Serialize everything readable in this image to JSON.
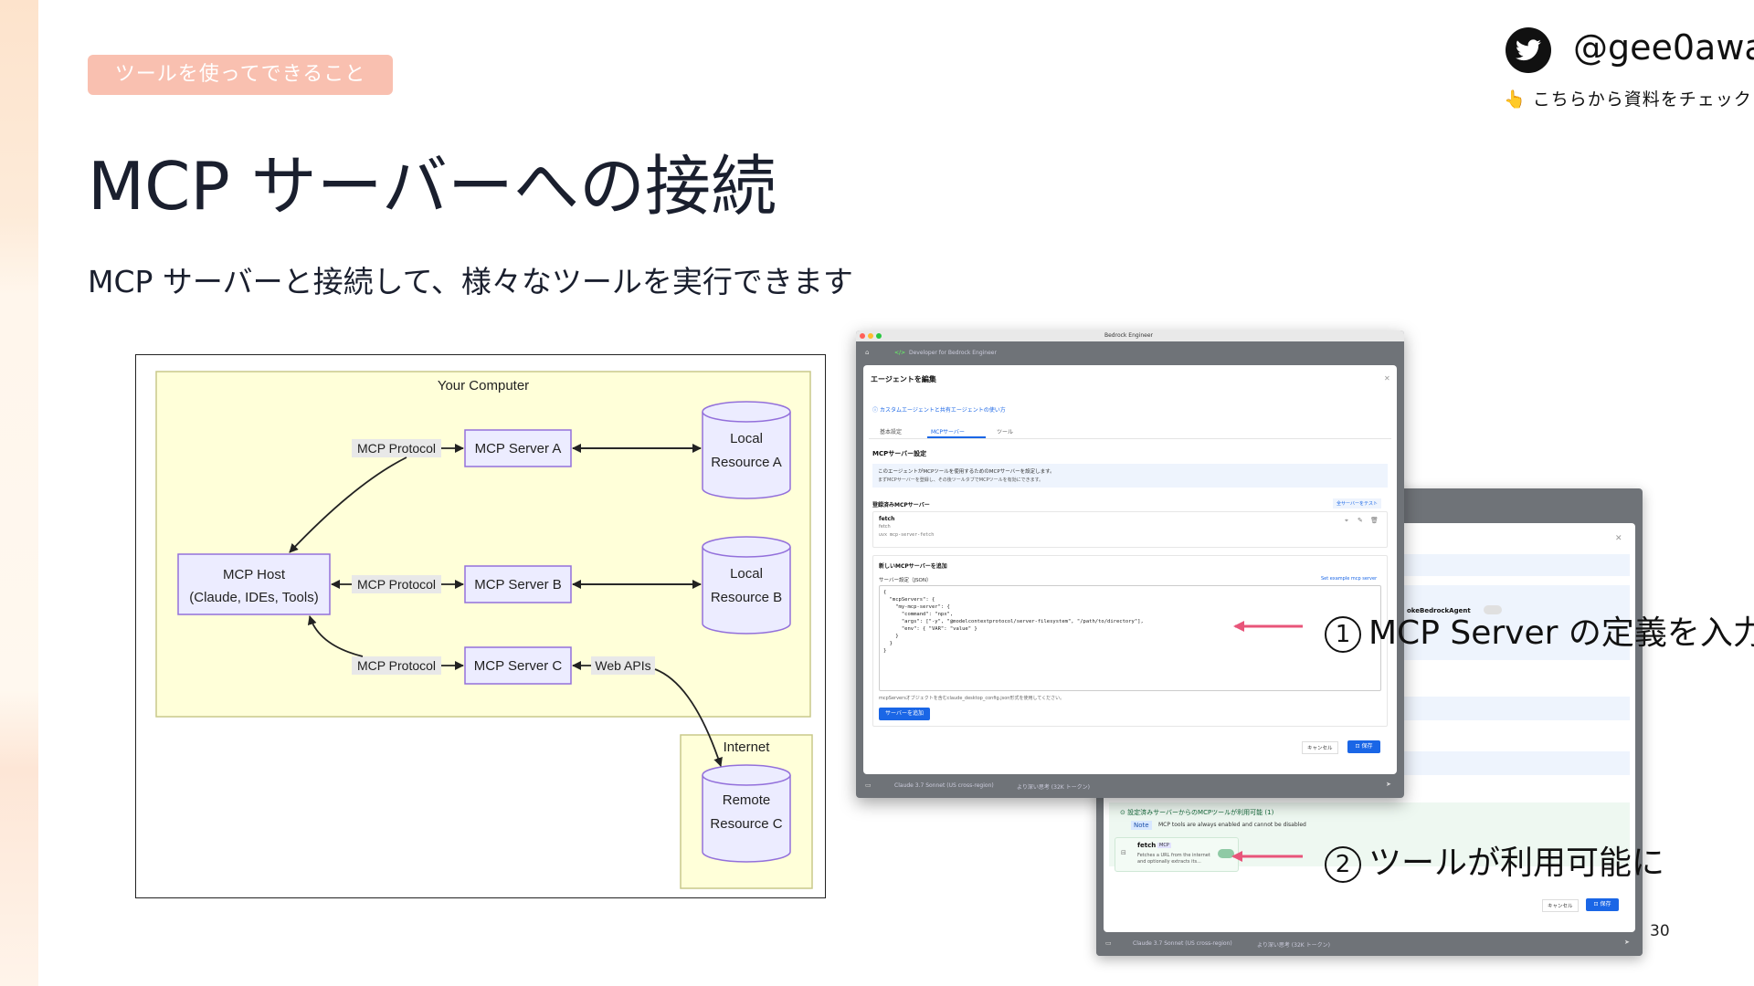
{
  "slide": {
    "tag": "ツールを使ってできること",
    "title": "MCP サーバーへの接続",
    "subtitle": "MCP サーバーと接続して、様々なツールを実行できます",
    "page_number": "30"
  },
  "social": {
    "icon": "twitter-bird-icon",
    "handle": "@gee0awa",
    "pointer_emoji": "👆",
    "check_text": "こちらから資料をチェック"
  },
  "diagram": {
    "your_computer": "Your Computer",
    "internet": "Internet",
    "host_line1": "MCP Host",
    "host_line2": "(Claude, IDEs, Tools)",
    "protocol_label": "MCP Protocol",
    "server_a": "MCP Server A",
    "server_b": "MCP Server B",
    "server_c": "MCP Server C",
    "web_apis": "Web APIs",
    "res_a_line1": "Local",
    "res_a_line2": "Resource A",
    "res_b_line1": "Local",
    "res_b_line2": "Resource B",
    "res_c_line1": "Remote",
    "res_c_line2": "Resource C",
    "colors": {
      "yellow": "#ffffd9",
      "yellow_border": "#c9c98a",
      "node": "#ececff",
      "node_border": "#9370db"
    }
  },
  "screenshot1": {
    "window_title": "Bedrock Engineer",
    "app_header": "Developer for Bedrock Engineer",
    "dialog_title": "エージェントを編集",
    "help_link": "カスタムエージェントと共有エージェントの使い方",
    "tabs": [
      "基本設定",
      "MCPサーバー",
      "ツール"
    ],
    "section_title": "MCPサーバー設定",
    "info_line1": "このエージェントがMCPツールを使用するためのMCPサーバーを設定します。",
    "info_line2": "まずMCPサーバーを登録し、その後ツールタブでMCPツールを有効にできます。",
    "registered_title": "登録済みMCPサーバー",
    "test_button": "全サーバーをテスト",
    "server_name": "fetch",
    "server_sub1": "fetch",
    "server_sub2": "uvx mcp-server-fetch",
    "add_title": "新しいMCPサーバーを追加",
    "json_label": "サーバー設定（JSON）",
    "example_link": "Set example mcp server",
    "json_code": "{\n  \"mcpServers\": {\n    \"my-mcp-server\": {\n      \"command\": \"npx\",\n      \"args\": [\"-y\", \"@modelcontextprotocol/server-filesystem\", \"/path/to/directory\"],\n      \"env\": { \"VAR\": \"value\" }\n    }\n  }\n}",
    "hint": "mcpServersオブジェクトを含むclaude_desktop_config.json形式を使用してください。",
    "add_button": "サーバーを追加",
    "cancel_button": "キャンセル",
    "save_button": "保存",
    "model_label": "Claude 3.7 Sonnet (US cross-region)",
    "thinking_label": "より深い思考 (32K トークン)"
  },
  "screenshot2": {
    "agent_label": "okeBedrockAgent",
    "available_title": "設定済みサーバーからのMCPツールが利用可能 (1)",
    "note_badge": "Note",
    "note_text": "MCP tools are always enabled and cannot be disabled",
    "tool_name": "fetch",
    "tool_badge": "MCP",
    "tool_desc1": "Fetches a URL from the internet",
    "tool_desc2": "and optionally extracts its...",
    "cancel_button": "キャンセル",
    "save_button": "保存",
    "model_label": "Claude 3.7 Sonnet (US cross-region)",
    "thinking_label": "より深い思考 (32K トークン)"
  },
  "annotations": {
    "num1": "1",
    "text1": "MCP Server の定義を入力",
    "num2": "2",
    "text2": "ツールが利用可能に",
    "arrow_color": "#e8557a"
  }
}
